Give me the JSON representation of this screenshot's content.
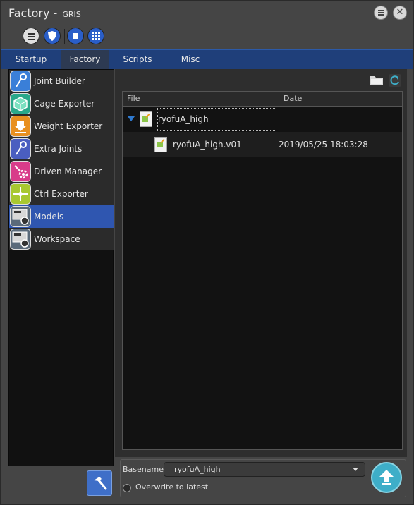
{
  "window": {
    "title": "Factory - ",
    "subtitle": "GRIS",
    "menu_icon": "menu-icon",
    "close_label": "✕"
  },
  "toolbar": {
    "icons": [
      "menu-icon",
      "shield-icon",
      "square-icon",
      "grid-icon"
    ]
  },
  "tabs": [
    {
      "label": "Startup",
      "active": false
    },
    {
      "label": "Factory",
      "active": true
    },
    {
      "label": "Scripts",
      "active": false
    },
    {
      "label": "Misc",
      "active": false
    }
  ],
  "sidebar": {
    "items": [
      {
        "label": "Joint Builder",
        "icon": "joint-builder-icon",
        "color": "#3a7fd8"
      },
      {
        "label": "Cage Exporter",
        "icon": "cage-exporter-icon",
        "color": "#2aa88a"
      },
      {
        "label": "Weight Exporter",
        "icon": "weight-exporter-icon",
        "color": "#e89020"
      },
      {
        "label": "Extra Joints",
        "icon": "extra-joints-icon",
        "color": "#4a5ec0"
      },
      {
        "label": "Driven Manager",
        "icon": "driven-manager-icon",
        "color": "#d83c8a"
      },
      {
        "label": "Ctrl Exporter",
        "icon": "ctrl-exporter-icon",
        "color": "#a8c830"
      },
      {
        "label": "Models",
        "icon": "models-icon",
        "color": "#5a6a7a",
        "active": true
      },
      {
        "label": "Workspace",
        "icon": "workspace-icon",
        "color": "#5a6a7a"
      }
    ]
  },
  "file_browser": {
    "columns": [
      "File",
      "Date"
    ],
    "rows": [
      {
        "name": "ryofuA_high",
        "date": "",
        "expanded": true,
        "level": 0
      },
      {
        "name": "ryofuA_high.v01",
        "date": "2019/05/25 18:03:28",
        "level": 1
      }
    ]
  },
  "basename": {
    "label": "Basename",
    "value": "ryofuA_high"
  },
  "overwrite": {
    "label": "Overwrite to latest",
    "checked": false
  },
  "colors": {
    "accent": "#2f56b0",
    "tab_bar": "#1f3f7a",
    "upload": "#3eaec8"
  }
}
